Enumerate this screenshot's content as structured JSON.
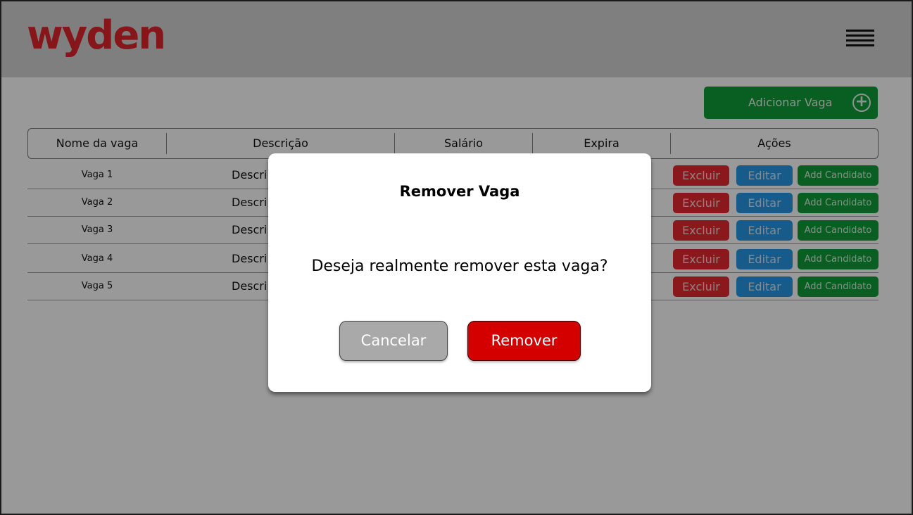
{
  "header": {
    "logo": "wyden",
    "menu_icon": "hamburger-menu-icon"
  },
  "toolbar": {
    "add_label": "Adicionar Vaga",
    "add_icon": "plus-circle-icon"
  },
  "table": {
    "columns": [
      "Nome da vaga",
      "Descrição",
      "Salário",
      "Expira",
      "Ações"
    ],
    "rows": [
      {
        "name": "Vaga 1",
        "desc": "Descri"
      },
      {
        "name": "Vaga 2",
        "desc": "Descri"
      },
      {
        "name": "Vaga 3",
        "desc": "Descri"
      },
      {
        "name": "Vaga 4",
        "desc": "Descri"
      },
      {
        "name": "Vaga 5",
        "desc": "Descri"
      }
    ],
    "actions": {
      "delete": "Excluir",
      "edit": "Editar",
      "add_candidate": "Add Candidato"
    }
  },
  "modal": {
    "title": "Remover Vaga",
    "message": "Deseja realmente remover esta vaga?",
    "cancel_label": "Cancelar",
    "remove_label": "Remover"
  },
  "colors": {
    "brand": "#e0262b",
    "success": "#109e3a",
    "danger": "#e8282f",
    "info": "#2798e8",
    "remove": "#d40000"
  }
}
